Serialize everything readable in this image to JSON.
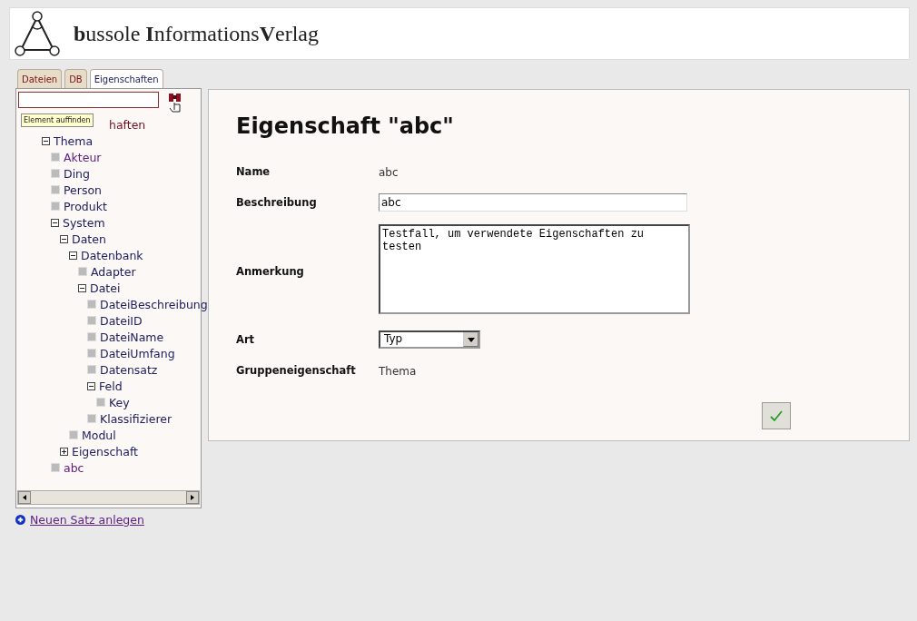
{
  "header": {
    "brand_prefix": "b",
    "brand_1": "ussole ",
    "brand_2": "I",
    "brand_3": "nformations",
    "brand_4": "V",
    "brand_5": "erlag"
  },
  "tabs": [
    {
      "label": "Dateien",
      "selected": false
    },
    {
      "label": "DB",
      "selected": false
    },
    {
      "label": "Eigenschaften",
      "selected": true
    }
  ],
  "search": {
    "tooltip": "Element auffinden"
  },
  "tree": {
    "label": "haften",
    "children": [
      {
        "label": "Thema",
        "kind": "folder",
        "expanded": true,
        "visited": false,
        "children": [
          {
            "label": "Akteur",
            "kind": "leaf",
            "visited": true
          },
          {
            "label": "Ding",
            "kind": "leaf",
            "visited": false
          },
          {
            "label": "Person",
            "kind": "leaf",
            "visited": false
          },
          {
            "label": "Produkt",
            "kind": "leaf",
            "visited": false
          },
          {
            "label": "System",
            "kind": "folder",
            "expanded": true,
            "visited": false,
            "children": [
              {
                "label": "Daten",
                "kind": "folder",
                "expanded": true,
                "visited": false,
                "children": [
                  {
                    "label": "Datenbank",
                    "kind": "folder",
                    "expanded": true,
                    "visited": false,
                    "children": [
                      {
                        "label": "Adapter",
                        "kind": "leaf",
                        "visited": false
                      },
                      {
                        "label": "Datei",
                        "kind": "folder",
                        "expanded": true,
                        "visited": false,
                        "children": [
                          {
                            "label": "DateiBeschreibung",
                            "kind": "leaf",
                            "visited": false
                          },
                          {
                            "label": "DateiID",
                            "kind": "leaf",
                            "visited": false
                          },
                          {
                            "label": "DateiName",
                            "kind": "leaf",
                            "visited": false
                          },
                          {
                            "label": "DateiUmfang",
                            "kind": "leaf",
                            "visited": false
                          },
                          {
                            "label": "Datensatz",
                            "kind": "leaf",
                            "visited": false
                          },
                          {
                            "label": "Feld",
                            "kind": "folder",
                            "expanded": true,
                            "visited": false,
                            "children": [
                              {
                                "label": "Key",
                                "kind": "leaf",
                                "visited": false
                              }
                            ]
                          },
                          {
                            "label": "Klassifizierer",
                            "kind": "leaf",
                            "visited": false
                          }
                        ]
                      }
                    ]
                  },
                  {
                    "label": "Modul",
                    "kind": "leaf",
                    "visited": false
                  }
                ]
              },
              {
                "label": "Eigenschaft",
                "kind": "folder",
                "expanded": false,
                "visited": false
              }
            ]
          },
          {
            "label": "abc",
            "kind": "leaf",
            "visited": true
          }
        ]
      }
    ]
  },
  "new_record_link": "Neuen Satz anlegen",
  "detail": {
    "title": "Eigenschaft \"abc\"",
    "fields": [
      {
        "label": "Name",
        "kind": "text",
        "value": "abc"
      },
      {
        "label": "Beschreibung",
        "kind": "input",
        "value": "abc"
      },
      {
        "label": "Anmerkung",
        "kind": "textarea",
        "value": "Testfall, um verwendete Eigenschaften zu testen"
      },
      {
        "label": "Art",
        "kind": "select",
        "value": "Typ"
      },
      {
        "label": "Gruppeneigenschaft",
        "kind": "text",
        "value": "Thema"
      }
    ]
  }
}
